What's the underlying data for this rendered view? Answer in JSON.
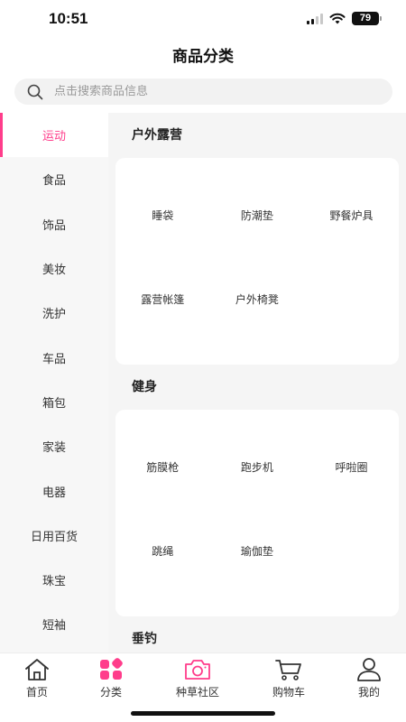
{
  "status": {
    "time": "10:51",
    "battery": "79"
  },
  "header": {
    "title": "商品分类"
  },
  "search": {
    "placeholder": "点击搜索商品信息"
  },
  "sidebar": {
    "items": [
      {
        "label": "运动",
        "active": true
      },
      {
        "label": "食品"
      },
      {
        "label": "饰品"
      },
      {
        "label": "美妆"
      },
      {
        "label": "洗护"
      },
      {
        "label": "车品"
      },
      {
        "label": "箱包"
      },
      {
        "label": "家装"
      },
      {
        "label": "电器"
      },
      {
        "label": "日用百货"
      },
      {
        "label": "珠宝"
      },
      {
        "label": "短袖"
      }
    ]
  },
  "sections": [
    {
      "title": "户外露营",
      "items": [
        "睡袋",
        "防潮垫",
        "野餐炉具",
        "露营帐篷",
        "户外椅凳"
      ]
    },
    {
      "title": "健身",
      "items": [
        "筋膜枪",
        "跑步机",
        "呼啦圈",
        "跳绳",
        "瑜伽垫"
      ]
    },
    {
      "title": "垂钓",
      "items": []
    }
  ],
  "tabbar": {
    "items": [
      {
        "label": "首页",
        "icon": "home-icon"
      },
      {
        "label": "分类",
        "icon": "category-icon",
        "active": true
      },
      {
        "label": "种草社区",
        "icon": "camera-icon"
      },
      {
        "label": "购物车",
        "icon": "cart-icon"
      },
      {
        "label": "我的",
        "icon": "profile-icon"
      }
    ]
  },
  "colors": {
    "accent": "#ff3d8b",
    "sidebar_bg": "#f7f7f7",
    "content_bg": "#f5f5f5"
  }
}
